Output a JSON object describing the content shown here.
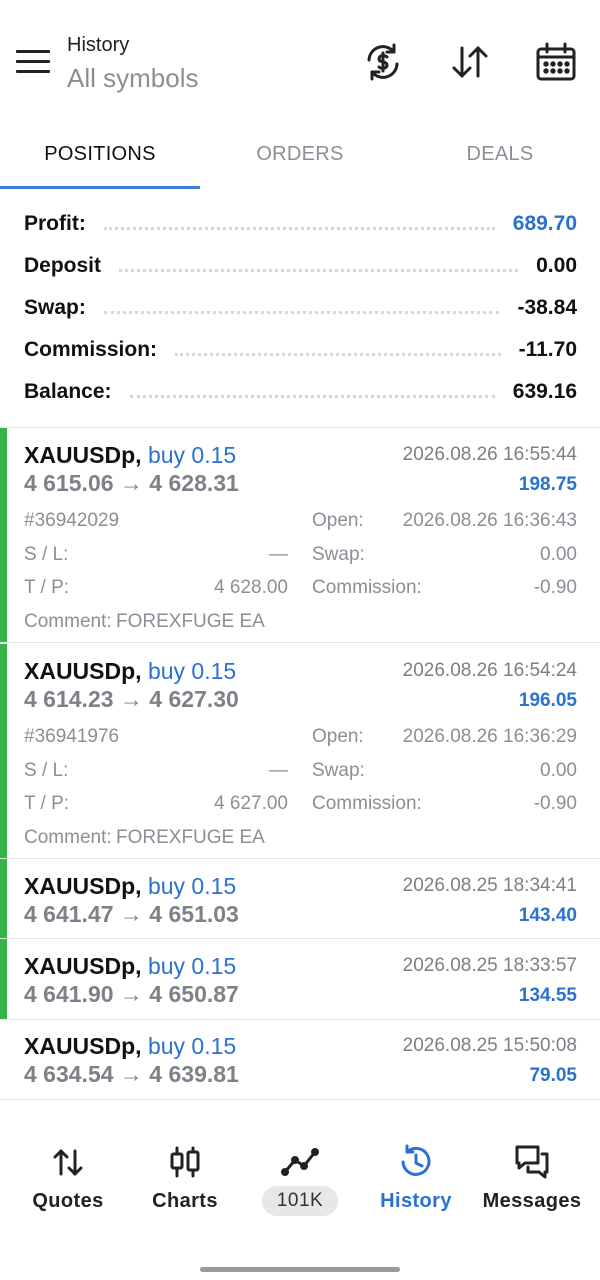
{
  "header": {
    "title": "History",
    "subtitle": "All symbols",
    "icons": [
      "menu-icon",
      "currency-exchange-icon",
      "sort-icon",
      "calendar-icon"
    ]
  },
  "tabs": [
    {
      "label": "POSITIONS",
      "active": true
    },
    {
      "label": "ORDERS",
      "active": false
    },
    {
      "label": "DEALS",
      "active": false
    }
  ],
  "summary": {
    "profit": {
      "label": "Profit:",
      "value": "689.70"
    },
    "deposit": {
      "label": "Deposit",
      "value": "0.00"
    },
    "swap": {
      "label": "Swap:",
      "value": "-38.84"
    },
    "commission": {
      "label": "Commission:",
      "value": "-11.70"
    },
    "balance": {
      "label": "Balance:",
      "value": "639.16"
    }
  },
  "labels": {
    "open": "Open:",
    "sl": "S / L:",
    "tp": "T / P:",
    "swap": "Swap:",
    "commission": "Commission:",
    "comment": "Comment:"
  },
  "positions": [
    {
      "symbol": "XAUUSDp,",
      "direction": "buy 0.15",
      "time": "2026.08.26 16:55:44",
      "prices": "4 615.06 → 4 628.31",
      "profit": "198.75",
      "ticket": "#36942029",
      "open": "2026.08.26 16:36:43",
      "sl": "—",
      "tp": "4 628.00",
      "swap": "0.00",
      "commission": "-0.90",
      "comment": "FOREXFUGE EA"
    },
    {
      "symbol": "XAUUSDp,",
      "direction": "buy 0.15",
      "time": "2026.08.26 16:54:24",
      "prices": "4 614.23 → 4 627.30",
      "profit": "196.05",
      "ticket": "#36941976",
      "open": "2026.08.26 16:36:29",
      "sl": "—",
      "tp": "4 627.00",
      "swap": "0.00",
      "commission": "-0.90",
      "comment": "FOREXFUGE EA"
    },
    {
      "symbol": "XAUUSDp,",
      "direction": "buy 0.15",
      "time": "2026.08.25 18:34:41",
      "prices": "4 641.47 → 4 651.03",
      "profit": "143.40"
    },
    {
      "symbol": "XAUUSDp,",
      "direction": "buy 0.15",
      "time": "2026.08.25 18:33:57",
      "prices": "4 641.90 → 4 650.87",
      "profit": "134.55"
    },
    {
      "symbol": "XAUUSDp,",
      "direction": "buy 0.15",
      "time": "2026.08.25 15:50:08",
      "prices": "4 634.54 → 4 639.81",
      "profit": "79.05"
    }
  ],
  "nav": [
    {
      "label": "Quotes",
      "icon": "quotes-icon"
    },
    {
      "label": "Charts",
      "icon": "candlestick-icon"
    },
    {
      "label": "101K",
      "icon": "trade-line-icon"
    },
    {
      "label": "History",
      "icon": "history-icon",
      "active": true
    },
    {
      "label": "Messages",
      "icon": "messages-icon"
    }
  ],
  "colors": {
    "accent": "#2a72d2",
    "profit_bar": "#36b449",
    "muted": "#8a8f96"
  }
}
